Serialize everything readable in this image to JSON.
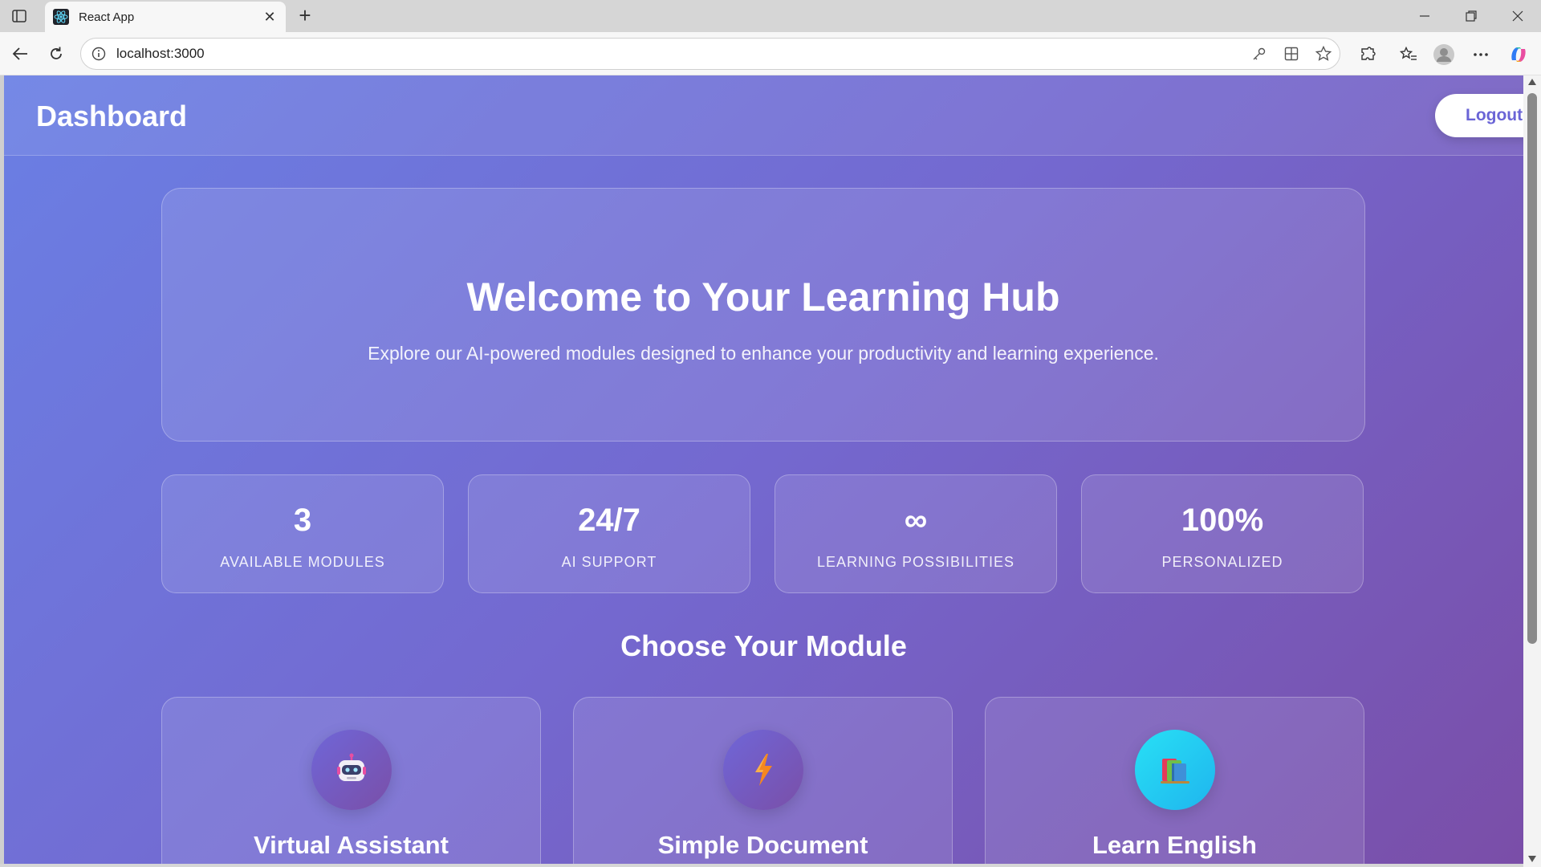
{
  "browser": {
    "tab_title": "React App",
    "url": "localhost:3000"
  },
  "header": {
    "title": "Dashboard",
    "logout_label": "Logout"
  },
  "hero": {
    "title": "Welcome to Your Learning Hub",
    "subtitle": "Explore our AI-powered modules designed to enhance your productivity and learning experience."
  },
  "stats": [
    {
      "value": "3",
      "label": "AVAILABLE MODULES"
    },
    {
      "value": "24/7",
      "label": "AI SUPPORT"
    },
    {
      "value": "∞",
      "label": "LEARNING POSSIBILITIES"
    },
    {
      "value": "100%",
      "label": "PERSONALIZED"
    }
  ],
  "modules_section": {
    "title": "Choose Your Module",
    "modules": [
      {
        "title": "Virtual Assistant",
        "icon": "robot-icon"
      },
      {
        "title": "Simple Document",
        "icon": "lightning-icon"
      },
      {
        "title": "Learn English",
        "icon": "books-icon"
      }
    ]
  },
  "colors": {
    "gradient_start": "#6a7fe4",
    "gradient_mid": "#7468cf",
    "gradient_end": "#7a4ea8",
    "logout_text": "#6a64d6",
    "books_icon_bg": "#1fd3f2"
  }
}
